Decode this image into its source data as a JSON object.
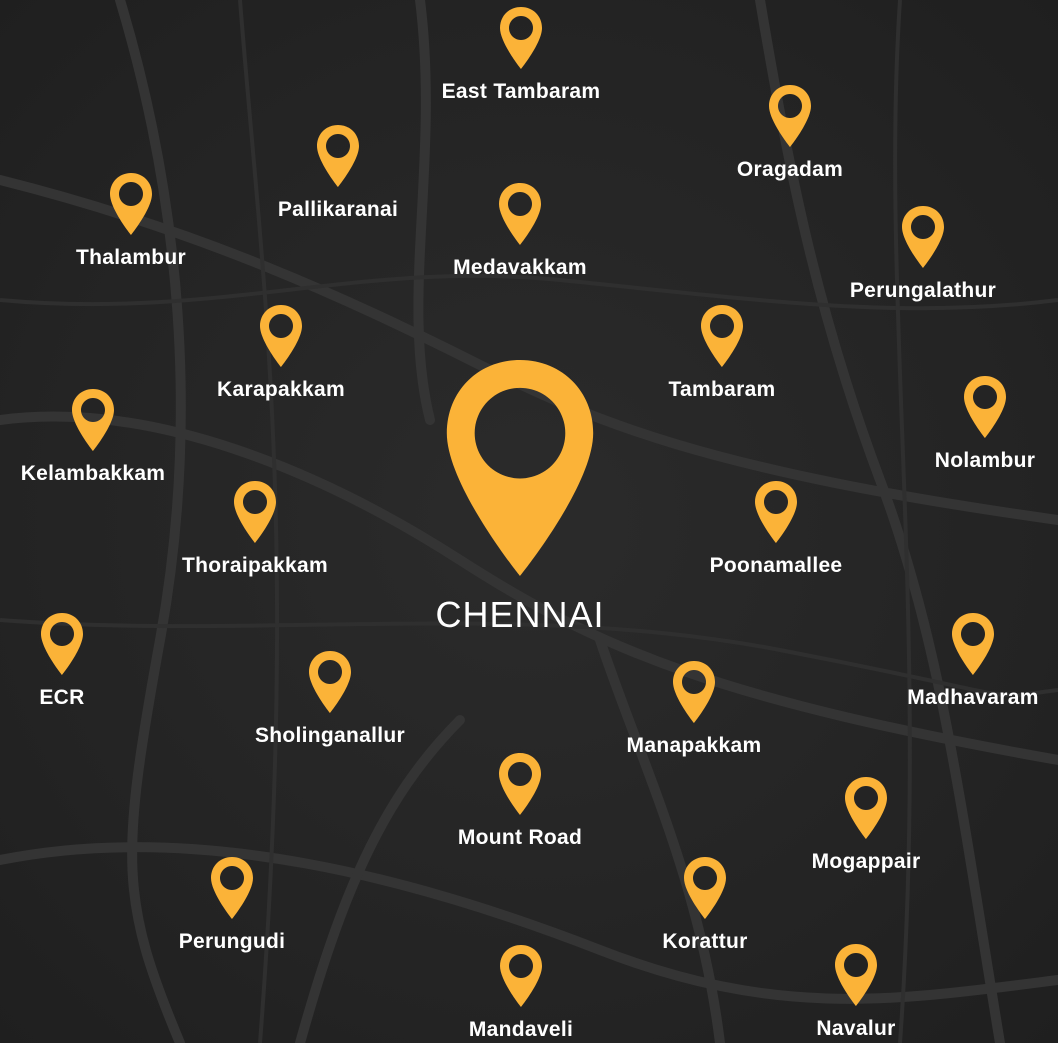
{
  "colors": {
    "pin": "#FBB338",
    "background": "#262626",
    "text": "#FFFFFF",
    "roads": "#343434"
  },
  "icons": {
    "location": "map-pin-icon"
  },
  "city": {
    "name": "CHENNAI"
  },
  "locations": [
    "East Tambaram",
    "Oragadam",
    "Pallikaranai",
    "Thalambur",
    "Medavakkam",
    "Perungalathur",
    "Karapakkam",
    "Tambaram",
    "Kelambakkam",
    "Nolambur",
    "Thoraipakkam",
    "Poonamallee",
    "ECR",
    "Madhavaram",
    "Sholinganallur",
    "Manapakkam",
    "Mount Road",
    "Mogappair",
    "Perungudi",
    "Korattur",
    "Mandaveli",
    "Navalur"
  ]
}
